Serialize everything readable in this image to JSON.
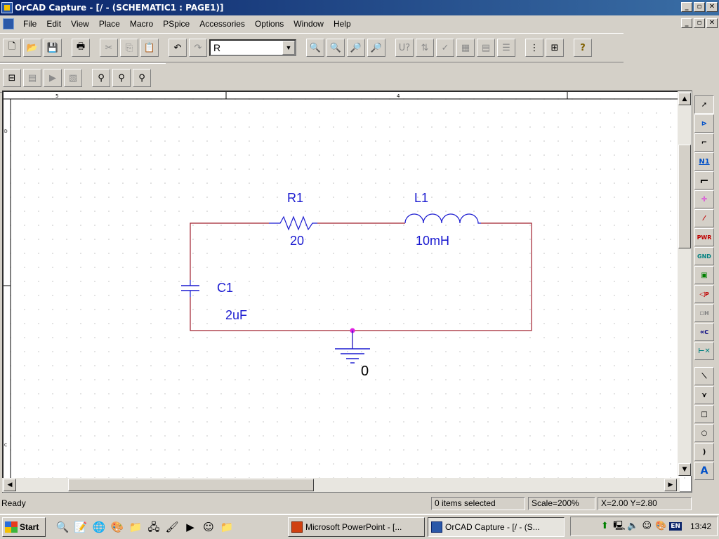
{
  "window": {
    "title": "OrCAD Capture - [/ - (SCHEMATIC1 : PAGE1)]",
    "controls": [
      "_",
      "▫",
      "✕"
    ]
  },
  "menu": {
    "items": [
      "File",
      "Edit",
      "View",
      "Place",
      "Macro",
      "PSpice",
      "Accessories",
      "Options",
      "Window",
      "Help"
    ]
  },
  "toolbar": {
    "part_field_value": "R",
    "main_icons": [
      "new-icon",
      "open-icon",
      "save-icon",
      "print-icon",
      "cut-icon",
      "copy-icon",
      "paste-icon",
      "undo-icon",
      "redo-icon"
    ],
    "zoom_icons": [
      "zoom-in-icon",
      "zoom-out-icon",
      "zoom-area-icon",
      "zoom-all-icon"
    ],
    "tool_icons": [
      "annotate-icon",
      "back-annotate-icon",
      "drc-icon",
      "netlist-icon",
      "cross-reference-icon",
      "bill-of-materials-icon",
      "snap-to-grid-icon",
      "project-manager-icon",
      "help-icon"
    ],
    "pspice_icons": [
      "new-simulation-icon",
      "edit-simulation-icon",
      "run-icon",
      "view-results-icon",
      "voltage-marker-icon",
      "current-marker-icon",
      "power-marker-icon"
    ]
  },
  "schematic": {
    "border_marks": {
      "top_left": "5",
      "top_mid": "4",
      "left_top": "D",
      "left_bottom": "C"
    },
    "parts": [
      {
        "ref": "R1",
        "value": "20"
      },
      {
        "ref": "L1",
        "value": "10mH"
      },
      {
        "ref": "C1",
        "value": "2uF"
      }
    ],
    "ground_label": "0",
    "colors": {
      "wire": "#a0202e",
      "part": "#1a1ad0",
      "text": "#1a1ad0",
      "junction": "#e020e0",
      "grid": "#c0c0c0"
    }
  },
  "palette": {
    "tools": [
      "select-tool",
      "place-part-tool",
      "place-wire-tool",
      "place-net-alias-tool",
      "place-bus-tool",
      "place-junction-tool",
      "place-bus-entry-tool",
      "place-power-tool",
      "place-ground-tool",
      "place-hierarchical-block-tool",
      "place-port-tool",
      "place-hierarchical-pin-tool",
      "place-off-page-connector-tool",
      "place-no-connect-tool",
      "place-line-tool",
      "place-polyline-tool",
      "place-rectangle-tool",
      "place-ellipse-tool",
      "place-arc-tool",
      "place-text-tool"
    ],
    "labels": {
      "n1": "N1",
      "pwr": "PWR",
      "gnd": "GND",
      "port": "P",
      "hpin": "H",
      "offpage": "C",
      "text": "A"
    }
  },
  "status": {
    "state": "Ready",
    "selection": "0 items selected",
    "scale": "Scale=200%",
    "coords": "X=2.00  Y=2.80"
  },
  "taskbar": {
    "start_label": "Start",
    "tasks": [
      {
        "label": "Microsoft PowerPoint - [..."
      },
      {
        "label": "OrCAD Capture - [/ - (S..."
      }
    ],
    "language": "EN",
    "clock": "13:42"
  }
}
